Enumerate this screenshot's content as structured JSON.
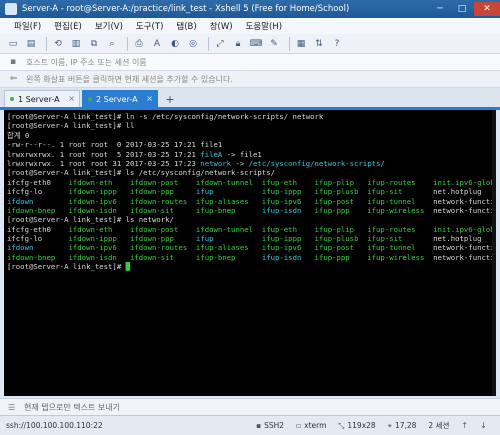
{
  "window": {
    "title": "Server-A - root@Server-A:/practice/link_test - Xshell 5 (Free for Home/School)",
    "min_glyph": "─",
    "max_glyph": "□",
    "close_glyph": "✕"
  },
  "menu": [
    "파일(F)",
    "편집(E)",
    "보기(V)",
    "도구(T)",
    "탭(B)",
    "창(W)",
    "도움말(H)"
  ],
  "address": {
    "placeholder": "호스트 이름, IP 주소 또는 세션 이름"
  },
  "hint": {
    "text": "왼쪽 화살표 버튼을 클릭하면 현재 세션을 추가할 수 있습니다."
  },
  "tabs": [
    {
      "label": "1 Server-A",
      "status_color": "#3ab14a",
      "active": false
    },
    {
      "label": "2 Server-A",
      "status_color": "#3ab14a",
      "active": true
    }
  ],
  "tab_add": "+",
  "tab_close": "×",
  "terminal": {
    "colors": {
      "default": "#d9d9d9",
      "green": "#31d33b",
      "cyan": "#33c7de",
      "bluebold": "#5f8cff"
    },
    "lines": [
      [
        {
          "t": "[root@Server-A link_test]# ln -s /etc/sysconfig/network-scripts/ network",
          "c": "default"
        }
      ],
      [
        {
          "t": "[root@Server-A link_test]# ll",
          "c": "default"
        }
      ],
      [
        {
          "t": "합계 0",
          "c": "default"
        }
      ],
      [
        {
          "t": "-rw-r--r--. 1 root root  0 2017-03-25 17:21 file1",
          "c": "default"
        }
      ],
      [
        {
          "t": "lrwxrwxrwx. 1 root root  5 2017-03-25 17:21 ",
          "c": "default"
        },
        {
          "t": "fileA",
          "c": "cyan"
        },
        {
          "t": " -> file1",
          "c": "default"
        }
      ],
      [
        {
          "t": "lrwxrwxrwx. 1 root root 31 2017-03-25 17:23 ",
          "c": "default"
        },
        {
          "t": "network",
          "c": "cyan"
        },
        {
          "t": " -> ",
          "c": "default"
        },
        {
          "t": "/etc/sysconfig/network-scripts/",
          "c": "cyan"
        }
      ],
      [
        {
          "t": "[root@Server-A link_test]# ls /etc/sysconfig/network-scripts/",
          "c": "default"
        }
      ],
      [
        {
          "t": "ifcfg-eth0    ",
          "c": "default"
        },
        {
          "t": "ifdown-eth    ifdown-post    ifdown-tunnel  ifup-eth    ifup-plip   ifup-routes    init.ipv6-global",
          "c": "green"
        }
      ],
      [
        {
          "t": "ifcfg-lo      ",
          "c": "default"
        },
        {
          "t": "ifdown-ippp   ifdown-ppp     ",
          "c": "green"
        },
        {
          "t": "ifup",
          "c": "cyan"
        },
        {
          "t": "           ifup-ippp   ifup-plusb  ifup-sit       ",
          "c": "green"
        },
        {
          "t": "net.hotplug",
          "c": "default"
        }
      ],
      [
        {
          "t": "ifdown",
          "c": "cyan"
        },
        {
          "t": "        ifdown-ipv6   ifdown-routes  ifup-aliases   ifup-ipv6   ifup-post   ifup-tunnel    ",
          "c": "green"
        },
        {
          "t": "network-functions",
          "c": "default"
        }
      ],
      [
        {
          "t": "ifdown-bnep   ifdown-isdn   ifdown-sit     ifup-bnep      ",
          "c": "green"
        },
        {
          "t": "ifup-isdn",
          "c": "cyan"
        },
        {
          "t": "   ifup-ppp    ifup-wireless  ",
          "c": "green"
        },
        {
          "t": "network-functions-ipv6",
          "c": "default"
        }
      ],
      [
        {
          "t": "[root@Server-A link_test]# ls network/",
          "c": "default"
        }
      ],
      [
        {
          "t": "ifcfg-eth0    ",
          "c": "default"
        },
        {
          "t": "ifdown-eth    ifdown-post    ifdown-tunnel  ifup-eth    ifup-plip   ifup-routes    init.ipv6-global",
          "c": "green"
        }
      ],
      [
        {
          "t": "ifcfg-lo      ",
          "c": "default"
        },
        {
          "t": "ifdown-ippp   ifdown-ppp     ",
          "c": "green"
        },
        {
          "t": "ifup",
          "c": "cyan"
        },
        {
          "t": "           ifup-ippp   ifup-plusb  ifup-sit       ",
          "c": "green"
        },
        {
          "t": "net.hotplug",
          "c": "default"
        }
      ],
      [
        {
          "t": "ifdown",
          "c": "cyan"
        },
        {
          "t": "        ifdown-ipv6   ifdown-routes  ifup-aliases   ifup-ipv6   ifup-post   ifup-tunnel    ",
          "c": "green"
        },
        {
          "t": "network-functions",
          "c": "default"
        }
      ],
      [
        {
          "t": "ifdown-bnep   ifdown-isdn   ifdown-sit     ifup-bnep      ",
          "c": "green"
        },
        {
          "t": "ifup-isdn",
          "c": "cyan"
        },
        {
          "t": "   ifup-ppp    ifup-wireless  ",
          "c": "green"
        },
        {
          "t": "network-functions-ipv6",
          "c": "default"
        }
      ],
      [
        {
          "t": "[root@Server-A link_test]# ",
          "c": "default"
        },
        {
          "t": "█",
          "c": "green"
        }
      ]
    ]
  },
  "compose": {
    "text": "현재 탭으로만 텍스트 보내기"
  },
  "status": {
    "connection": "ssh://100.100.100.110:22",
    "protocol": "SSH2",
    "terminal": "xterm",
    "size": "119x28",
    "cursor": "17,28",
    "sessions": "2 세션"
  }
}
